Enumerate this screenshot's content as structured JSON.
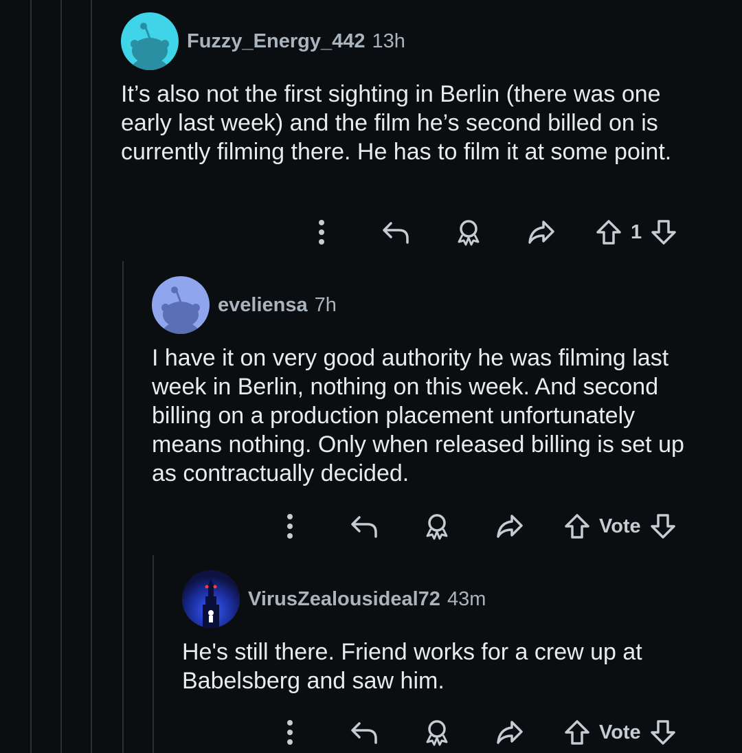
{
  "comments": [
    {
      "username": "Fuzzy_Energy_442",
      "time": "13h",
      "avatar_icon": "snoo-avatar-cyan",
      "avatar_color": "#3fd4e8",
      "text": "It’s also not the first sighting in Berlin (there was one early last week) and the film he’s second billed on is currently filming there. He has to film it at some point.",
      "vote_label": "1"
    },
    {
      "username": "eveliensa",
      "time": "7h",
      "avatar_icon": "snoo-avatar-periwinkle",
      "avatar_color": "#8fa6ee",
      "text": "I have it on very good authority he was filming last week in Berlin, nothing on this week. And second billing on a production placement unfortunately means nothing. Only when released billing is set up as contractually decided.",
      "vote_label": "Vote"
    },
    {
      "username": "VirusZealousideal72",
      "time": "43m",
      "avatar_icon": "castle-photo-avatar",
      "avatar_color": "#1a2e9c",
      "text": "He's still there. Friend works for a crew up at Babelsberg and saw him.",
      "vote_label": "Vote"
    }
  ],
  "actions": [
    "more-options",
    "reply",
    "award",
    "share",
    "upvote",
    "downvote"
  ]
}
